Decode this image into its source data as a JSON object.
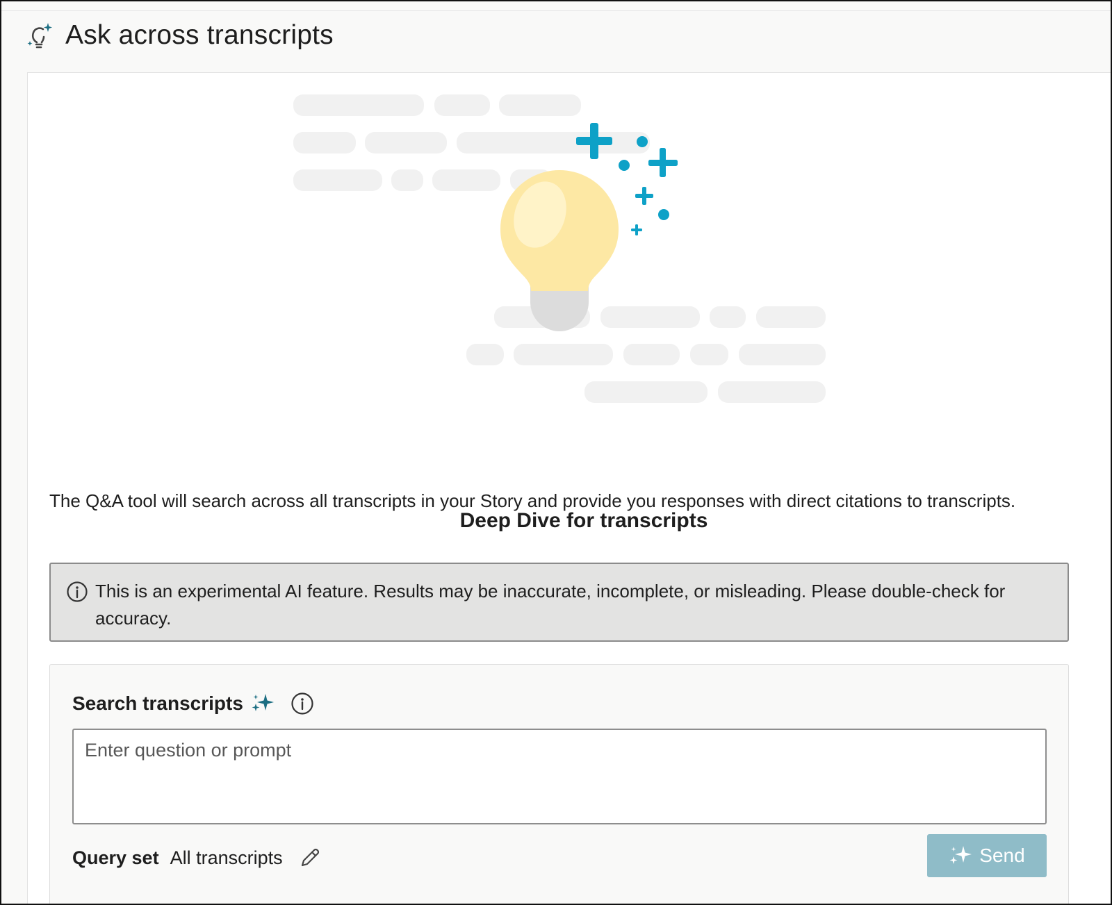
{
  "header": {
    "title": "Ask across transcripts",
    "icon": "lightbulb-sparkle-icon"
  },
  "main": {
    "section_title": "Deep Dive for transcripts",
    "description": "The Q&A tool will search across all transcripts in your Story and provide you responses with direct citations to transcripts.",
    "notice": {
      "icon": "info-icon",
      "text": "This is an experimental AI feature. Results may be inaccurate, incomplete, or misleading. Please double-check for accuracy."
    }
  },
  "search": {
    "label": "Search transcripts",
    "prompt_placeholder": "Enter question or prompt",
    "prompt_value": "",
    "query_set_label": "Query set",
    "query_set_value": "All transcripts",
    "send_label": "Send"
  },
  "colors": {
    "accent_teal": "#0ea1c7",
    "sparkle_dark_teal": "#1c6e82",
    "bulb_yellow": "#fde8a4",
    "placeholder_bar": "#f1f1f1",
    "send_button_disabled": "#8fbcc8",
    "notice_bg": "#e3e3e2"
  }
}
